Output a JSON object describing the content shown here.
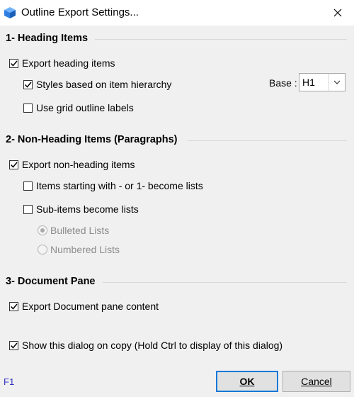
{
  "window": {
    "title": "Outline Export Settings...",
    "close_glyph": "✕"
  },
  "heading": {
    "title": "1- Heading Items",
    "export_heading_items": {
      "label": "Export heading items",
      "checked": true
    },
    "styles_hierarchy": {
      "label": "Styles based on item hierarchy",
      "checked": true
    },
    "grid_outline": {
      "label": "Use grid outline labels",
      "checked": false
    },
    "base": {
      "label": "Base :",
      "value": "H1"
    }
  },
  "non_heading": {
    "title": "2- Non-Heading Items (Paragraphs)",
    "export_non_heading": {
      "label": "Export non-heading items",
      "checked": true
    },
    "items_starting": {
      "label": "Items starting with - or 1- become lists",
      "checked": false
    },
    "sub_items": {
      "label": "Sub-items become lists",
      "checked": false
    },
    "bulleted": {
      "label": "Bulleted Lists",
      "selected": true,
      "enabled": false
    },
    "numbered": {
      "label": "Numbered Lists",
      "selected": false,
      "enabled": false
    }
  },
  "document": {
    "title": "3- Document Pane",
    "export_document_pane": {
      "label": "Export Document pane content",
      "checked": true
    }
  },
  "show_dialog": {
    "label": "Show this dialog on copy (Hold Ctrl to display of this dialog)",
    "checked": true
  },
  "footer": {
    "help": "F1",
    "ok_label": "OK",
    "cancel_label": "Cancel"
  },
  "colors": {
    "accent": "#0078d7",
    "help_link": "#3030c0",
    "app_icon": "#2f7de1"
  }
}
